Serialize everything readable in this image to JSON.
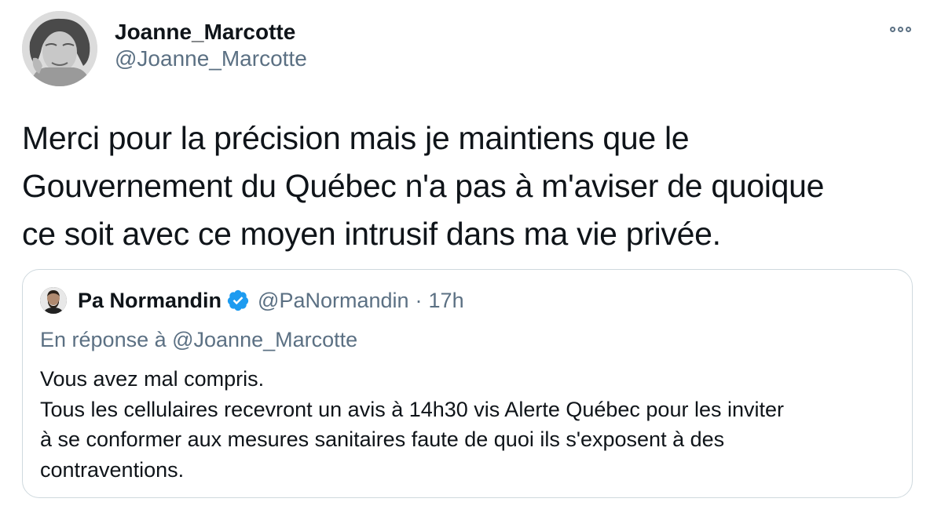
{
  "tweet": {
    "author": {
      "display_name": "Joanne_Marcotte",
      "handle": "@Joanne_Marcotte"
    },
    "text": "Merci pour la précision mais je maintiens que le\nGouvernement du Québec n'a pas à m'aviser de quoique\nce soit avec ce moyen intrusif dans ma vie privée.",
    "more_icon": "more-horizontal-icon"
  },
  "quoted_tweet": {
    "author": {
      "display_name": "Pa Normandin",
      "handle": "@PaNormandin",
      "verified": true
    },
    "separator": "·",
    "time": "17h",
    "reply_context": "En réponse à @Joanne_Marcotte",
    "text": "Vous avez mal compris.\nTous les cellulaires recevront un avis à 14h30 vis Alerte Québec pour les inviter\nà se conformer aux mesures sanitaires faute de quoi ils s'exposent à des\ncontraventions."
  },
  "colors": {
    "text_primary": "#0f1419",
    "text_secondary": "#5b7083",
    "verified_blue": "#1d9bf0",
    "border": "#cfd9de"
  }
}
